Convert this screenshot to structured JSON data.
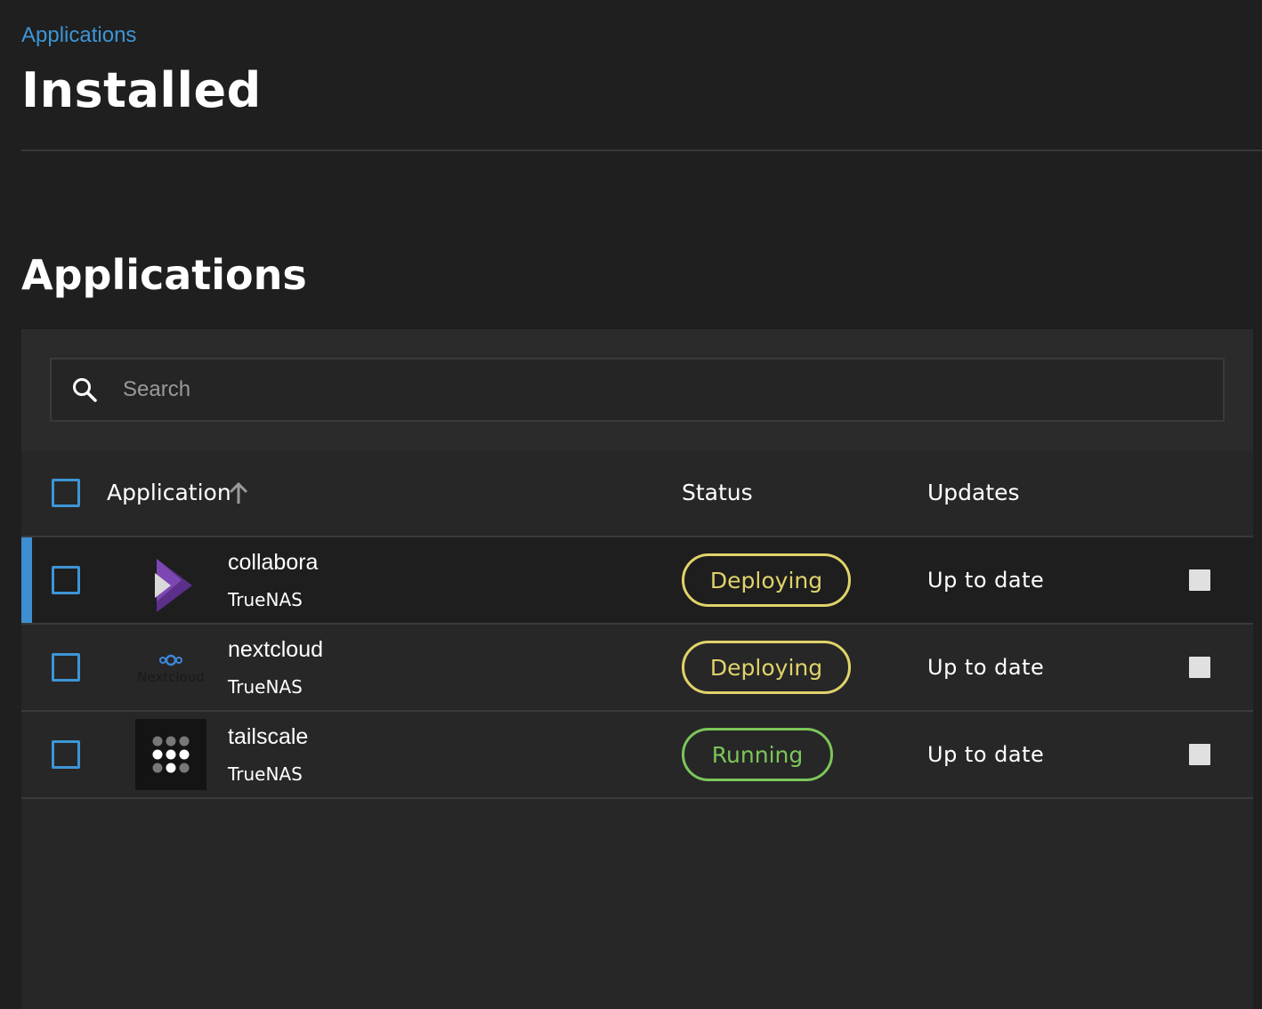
{
  "breadcrumb": {
    "label": "Applications"
  },
  "page": {
    "title": "Installed"
  },
  "section": {
    "title": "Applications"
  },
  "search": {
    "placeholder": "Search",
    "value": ""
  },
  "table": {
    "columns": {
      "application": "Application",
      "status": "Status",
      "updates": "Updates"
    },
    "sort": {
      "column": "application",
      "direction": "ascending",
      "icon": "arrow-up-icon"
    },
    "rows": [
      {
        "name": "collabora",
        "catalog": "TrueNAS",
        "status": "Deploying",
        "updates": "Up to date",
        "logo": "collabora-logo",
        "selected": true
      },
      {
        "name": "nextcloud",
        "catalog": "TrueNAS",
        "status": "Deploying",
        "updates": "Up to date",
        "logo": "nextcloud-logo",
        "logo_text": "Nextcloud",
        "selected": false
      },
      {
        "name": "tailscale",
        "catalog": "TrueNAS",
        "status": "Running",
        "updates": "Up to date",
        "logo": "tailscale-logo",
        "selected": false
      }
    ]
  },
  "colors": {
    "accent": "#3d95d6",
    "deploying": "#e0d36a",
    "running": "#7cc65a",
    "background": "#1f1f1f",
    "card": "#272727"
  }
}
